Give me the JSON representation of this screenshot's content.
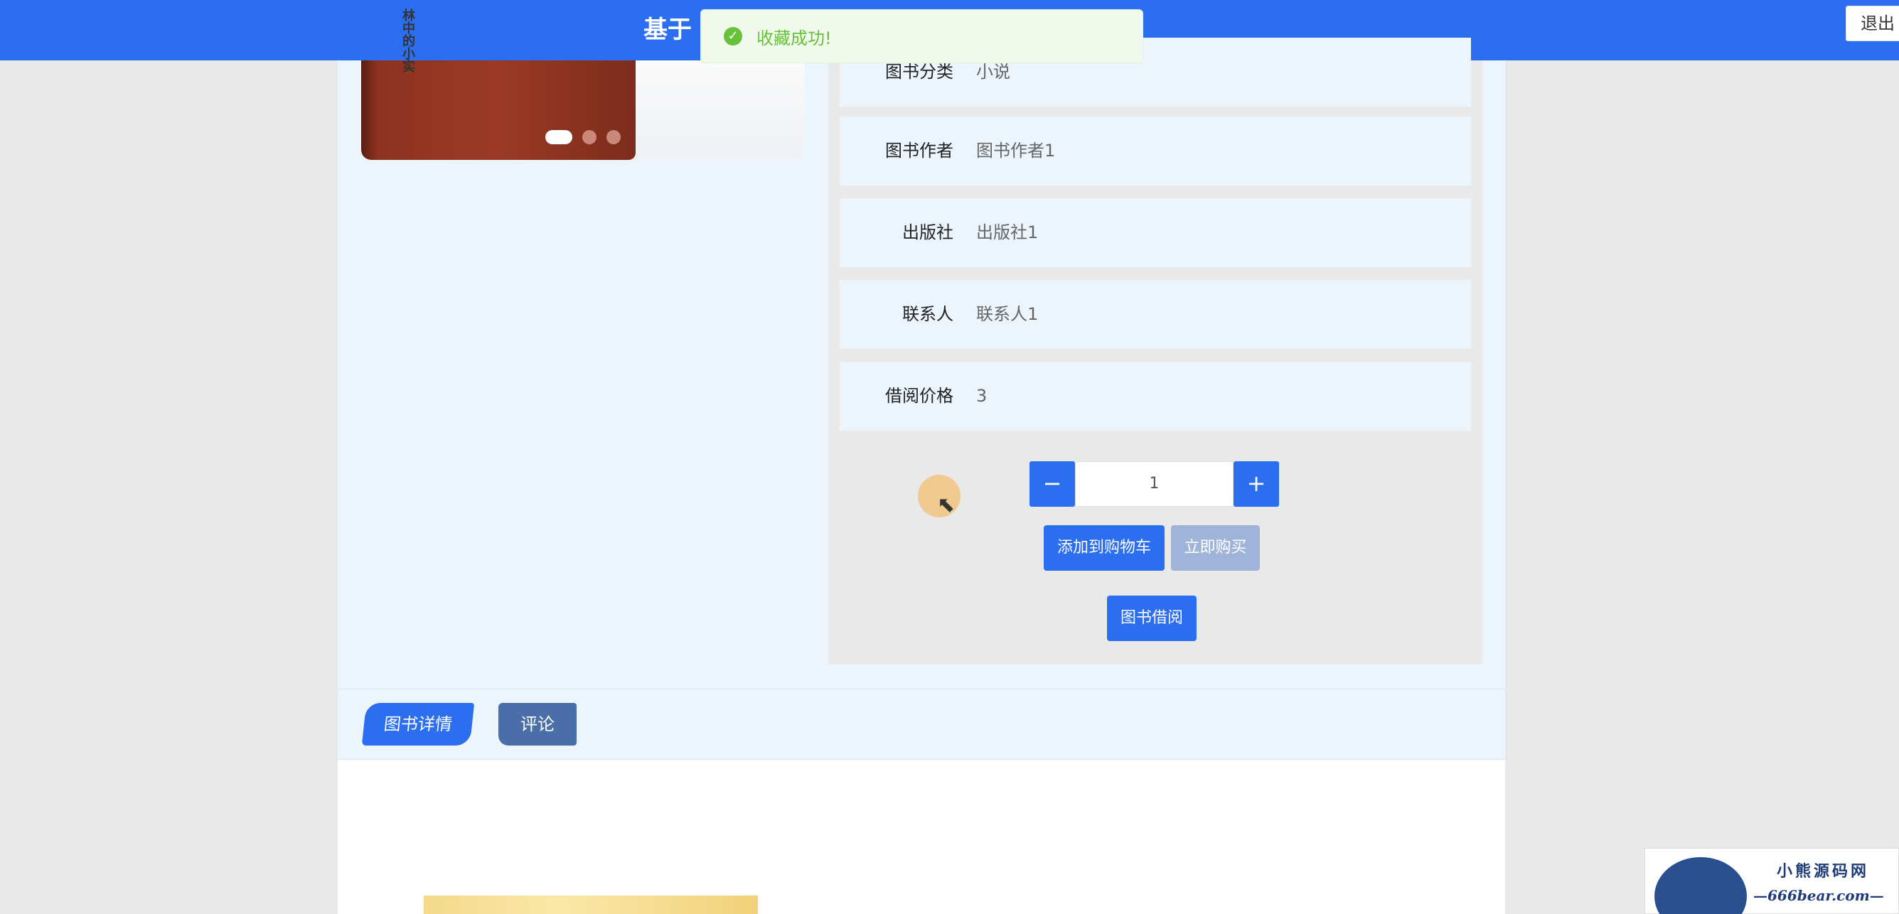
{
  "header": {
    "title": "基于",
    "user": "",
    "logout_label": "退出"
  },
  "toast": {
    "message": "收藏成功!"
  },
  "carousel": {
    "cover_text": "林中的小实",
    "dot_count": 3,
    "active_index": 0
  },
  "book_info": [
    {
      "label": "图书分类",
      "value": "小说"
    },
    {
      "label": "图书作者",
      "value": "图书作者1"
    },
    {
      "label": "出版社",
      "value": "出版社1"
    },
    {
      "label": "联系人",
      "value": "联系人1"
    },
    {
      "label": "借阅价格",
      "value": "3"
    }
  ],
  "quantity": {
    "decrement": "−",
    "value": "1",
    "increment": "+"
  },
  "actions": {
    "add_to_cart": "添加到购物车",
    "buy_now": "立即购买",
    "borrow": "图书借阅"
  },
  "tabs": [
    {
      "label": "图书详情",
      "active": true
    },
    {
      "label": "评论",
      "active": false
    }
  ],
  "watermark": {
    "title": "小熊源码网",
    "url": "—666bear.com—"
  },
  "colors": {
    "primary": "#2b6ef0",
    "success": "#67c23a",
    "disabled": "#a0b3d9",
    "panel_bg": "#edf5fc"
  }
}
